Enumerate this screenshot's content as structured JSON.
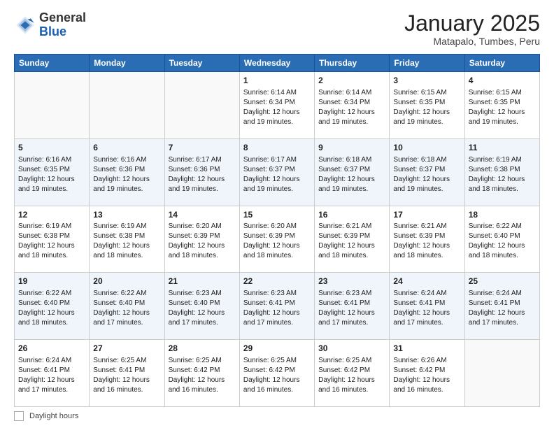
{
  "header": {
    "logo": {
      "general": "General",
      "blue": "Blue"
    },
    "title": "January 2025",
    "subtitle": "Matapalo, Tumbes, Peru"
  },
  "days_of_week": [
    "Sunday",
    "Monday",
    "Tuesday",
    "Wednesday",
    "Thursday",
    "Friday",
    "Saturday"
  ],
  "weeks": [
    [
      {
        "day": "",
        "empty": true
      },
      {
        "day": "",
        "empty": true
      },
      {
        "day": "",
        "empty": true
      },
      {
        "day": "1",
        "sunrise": "6:14 AM",
        "sunset": "6:34 PM",
        "daylight": "12 hours and 19 minutes."
      },
      {
        "day": "2",
        "sunrise": "6:14 AM",
        "sunset": "6:34 PM",
        "daylight": "12 hours and 19 minutes."
      },
      {
        "day": "3",
        "sunrise": "6:15 AM",
        "sunset": "6:35 PM",
        "daylight": "12 hours and 19 minutes."
      },
      {
        "day": "4",
        "sunrise": "6:15 AM",
        "sunset": "6:35 PM",
        "daylight": "12 hours and 19 minutes."
      }
    ],
    [
      {
        "day": "5",
        "sunrise": "6:16 AM",
        "sunset": "6:35 PM",
        "daylight": "12 hours and 19 minutes."
      },
      {
        "day": "6",
        "sunrise": "6:16 AM",
        "sunset": "6:36 PM",
        "daylight": "12 hours and 19 minutes."
      },
      {
        "day": "7",
        "sunrise": "6:17 AM",
        "sunset": "6:36 PM",
        "daylight": "12 hours and 19 minutes."
      },
      {
        "day": "8",
        "sunrise": "6:17 AM",
        "sunset": "6:37 PM",
        "daylight": "12 hours and 19 minutes."
      },
      {
        "day": "9",
        "sunrise": "6:18 AM",
        "sunset": "6:37 PM",
        "daylight": "12 hours and 19 minutes."
      },
      {
        "day": "10",
        "sunrise": "6:18 AM",
        "sunset": "6:37 PM",
        "daylight": "12 hours and 19 minutes."
      },
      {
        "day": "11",
        "sunrise": "6:19 AM",
        "sunset": "6:38 PM",
        "daylight": "12 hours and 18 minutes."
      }
    ],
    [
      {
        "day": "12",
        "sunrise": "6:19 AM",
        "sunset": "6:38 PM",
        "daylight": "12 hours and 18 minutes."
      },
      {
        "day": "13",
        "sunrise": "6:19 AM",
        "sunset": "6:38 PM",
        "daylight": "12 hours and 18 minutes."
      },
      {
        "day": "14",
        "sunrise": "6:20 AM",
        "sunset": "6:39 PM",
        "daylight": "12 hours and 18 minutes."
      },
      {
        "day": "15",
        "sunrise": "6:20 AM",
        "sunset": "6:39 PM",
        "daylight": "12 hours and 18 minutes."
      },
      {
        "day": "16",
        "sunrise": "6:21 AM",
        "sunset": "6:39 PM",
        "daylight": "12 hours and 18 minutes."
      },
      {
        "day": "17",
        "sunrise": "6:21 AM",
        "sunset": "6:39 PM",
        "daylight": "12 hours and 18 minutes."
      },
      {
        "day": "18",
        "sunrise": "6:22 AM",
        "sunset": "6:40 PM",
        "daylight": "12 hours and 18 minutes."
      }
    ],
    [
      {
        "day": "19",
        "sunrise": "6:22 AM",
        "sunset": "6:40 PM",
        "daylight": "12 hours and 18 minutes."
      },
      {
        "day": "20",
        "sunrise": "6:22 AM",
        "sunset": "6:40 PM",
        "daylight": "12 hours and 17 minutes."
      },
      {
        "day": "21",
        "sunrise": "6:23 AM",
        "sunset": "6:40 PM",
        "daylight": "12 hours and 17 minutes."
      },
      {
        "day": "22",
        "sunrise": "6:23 AM",
        "sunset": "6:41 PM",
        "daylight": "12 hours and 17 minutes."
      },
      {
        "day": "23",
        "sunrise": "6:23 AM",
        "sunset": "6:41 PM",
        "daylight": "12 hours and 17 minutes."
      },
      {
        "day": "24",
        "sunrise": "6:24 AM",
        "sunset": "6:41 PM",
        "daylight": "12 hours and 17 minutes."
      },
      {
        "day": "25",
        "sunrise": "6:24 AM",
        "sunset": "6:41 PM",
        "daylight": "12 hours and 17 minutes."
      }
    ],
    [
      {
        "day": "26",
        "sunrise": "6:24 AM",
        "sunset": "6:41 PM",
        "daylight": "12 hours and 17 minutes."
      },
      {
        "day": "27",
        "sunrise": "6:25 AM",
        "sunset": "6:41 PM",
        "daylight": "12 hours and 16 minutes."
      },
      {
        "day": "28",
        "sunrise": "6:25 AM",
        "sunset": "6:42 PM",
        "daylight": "12 hours and 16 minutes."
      },
      {
        "day": "29",
        "sunrise": "6:25 AM",
        "sunset": "6:42 PM",
        "daylight": "12 hours and 16 minutes."
      },
      {
        "day": "30",
        "sunrise": "6:25 AM",
        "sunset": "6:42 PM",
        "daylight": "12 hours and 16 minutes."
      },
      {
        "day": "31",
        "sunrise": "6:26 AM",
        "sunset": "6:42 PM",
        "daylight": "12 hours and 16 minutes."
      },
      {
        "day": "",
        "empty": true
      }
    ]
  ],
  "footer": {
    "daylight_label": "Daylight hours"
  }
}
